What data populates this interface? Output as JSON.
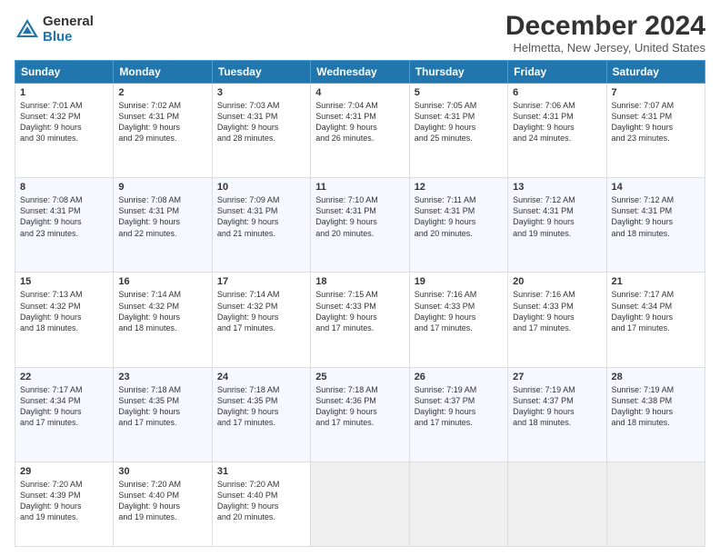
{
  "logo": {
    "general": "General",
    "blue": "Blue"
  },
  "title": "December 2024",
  "subtitle": "Helmetta, New Jersey, United States",
  "days": [
    "Sunday",
    "Monday",
    "Tuesday",
    "Wednesday",
    "Thursday",
    "Friday",
    "Saturday"
  ],
  "weeks": [
    [
      {
        "day": "1",
        "sunrise": "7:01 AM",
        "sunset": "4:32 PM",
        "daylight": "9 hours and 30 minutes."
      },
      {
        "day": "2",
        "sunrise": "7:02 AM",
        "sunset": "4:31 PM",
        "daylight": "9 hours and 29 minutes."
      },
      {
        "day": "3",
        "sunrise": "7:03 AM",
        "sunset": "4:31 PM",
        "daylight": "9 hours and 28 minutes."
      },
      {
        "day": "4",
        "sunrise": "7:04 AM",
        "sunset": "4:31 PM",
        "daylight": "9 hours and 26 minutes."
      },
      {
        "day": "5",
        "sunrise": "7:05 AM",
        "sunset": "4:31 PM",
        "daylight": "9 hours and 25 minutes."
      },
      {
        "day": "6",
        "sunrise": "7:06 AM",
        "sunset": "4:31 PM",
        "daylight": "9 hours and 24 minutes."
      },
      {
        "day": "7",
        "sunrise": "7:07 AM",
        "sunset": "4:31 PM",
        "daylight": "9 hours and 23 minutes."
      }
    ],
    [
      {
        "day": "8",
        "sunrise": "7:08 AM",
        "sunset": "4:31 PM",
        "daylight": "9 hours and 23 minutes."
      },
      {
        "day": "9",
        "sunrise": "7:08 AM",
        "sunset": "4:31 PM",
        "daylight": "9 hours and 22 minutes."
      },
      {
        "day": "10",
        "sunrise": "7:09 AM",
        "sunset": "4:31 PM",
        "daylight": "9 hours and 21 minutes."
      },
      {
        "day": "11",
        "sunrise": "7:10 AM",
        "sunset": "4:31 PM",
        "daylight": "9 hours and 20 minutes."
      },
      {
        "day": "12",
        "sunrise": "7:11 AM",
        "sunset": "4:31 PM",
        "daylight": "9 hours and 20 minutes."
      },
      {
        "day": "13",
        "sunrise": "7:12 AM",
        "sunset": "4:31 PM",
        "daylight": "9 hours and 19 minutes."
      },
      {
        "day": "14",
        "sunrise": "7:12 AM",
        "sunset": "4:31 PM",
        "daylight": "9 hours and 18 minutes."
      }
    ],
    [
      {
        "day": "15",
        "sunrise": "7:13 AM",
        "sunset": "4:32 PM",
        "daylight": "9 hours and 18 minutes."
      },
      {
        "day": "16",
        "sunrise": "7:14 AM",
        "sunset": "4:32 PM",
        "daylight": "9 hours and 18 minutes."
      },
      {
        "day": "17",
        "sunrise": "7:14 AM",
        "sunset": "4:32 PM",
        "daylight": "9 hours and 17 minutes."
      },
      {
        "day": "18",
        "sunrise": "7:15 AM",
        "sunset": "4:33 PM",
        "daylight": "9 hours and 17 minutes."
      },
      {
        "day": "19",
        "sunrise": "7:16 AM",
        "sunset": "4:33 PM",
        "daylight": "9 hours and 17 minutes."
      },
      {
        "day": "20",
        "sunrise": "7:16 AM",
        "sunset": "4:33 PM",
        "daylight": "9 hours and 17 minutes."
      },
      {
        "day": "21",
        "sunrise": "7:17 AM",
        "sunset": "4:34 PM",
        "daylight": "9 hours and 17 minutes."
      }
    ],
    [
      {
        "day": "22",
        "sunrise": "7:17 AM",
        "sunset": "4:34 PM",
        "daylight": "9 hours and 17 minutes."
      },
      {
        "day": "23",
        "sunrise": "7:18 AM",
        "sunset": "4:35 PM",
        "daylight": "9 hours and 17 minutes."
      },
      {
        "day": "24",
        "sunrise": "7:18 AM",
        "sunset": "4:35 PM",
        "daylight": "9 hours and 17 minutes."
      },
      {
        "day": "25",
        "sunrise": "7:18 AM",
        "sunset": "4:36 PM",
        "daylight": "9 hours and 17 minutes."
      },
      {
        "day": "26",
        "sunrise": "7:19 AM",
        "sunset": "4:37 PM",
        "daylight": "9 hours and 17 minutes."
      },
      {
        "day": "27",
        "sunrise": "7:19 AM",
        "sunset": "4:37 PM",
        "daylight": "9 hours and 18 minutes."
      },
      {
        "day": "28",
        "sunrise": "7:19 AM",
        "sunset": "4:38 PM",
        "daylight": "9 hours and 18 minutes."
      }
    ],
    [
      {
        "day": "29",
        "sunrise": "7:20 AM",
        "sunset": "4:39 PM",
        "daylight": "9 hours and 19 minutes."
      },
      {
        "day": "30",
        "sunrise": "7:20 AM",
        "sunset": "4:40 PM",
        "daylight": "9 hours and 19 minutes."
      },
      {
        "day": "31",
        "sunrise": "7:20 AM",
        "sunset": "4:40 PM",
        "daylight": "9 hours and 20 minutes."
      },
      null,
      null,
      null,
      null
    ]
  ]
}
